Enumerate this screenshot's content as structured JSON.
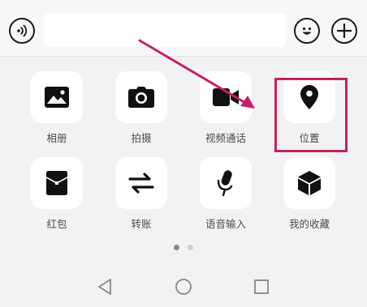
{
  "input_bar": {
    "message_value": "",
    "voice_icon": "voice-icon",
    "emoji_icon": "emoji-icon",
    "plus_icon": "plus-icon"
  },
  "panel": {
    "items": [
      {
        "label": "相册",
        "icon": "photo-album-icon"
      },
      {
        "label": "拍摄",
        "icon": "camera-icon"
      },
      {
        "label": "视频通话",
        "icon": "video-call-icon"
      },
      {
        "label": "位置",
        "icon": "location-pin-icon"
      },
      {
        "label": "红包",
        "icon": "red-packet-icon"
      },
      {
        "label": "转账",
        "icon": "transfer-icon"
      },
      {
        "label": "语音输入",
        "icon": "microphone-icon"
      },
      {
        "label": "我的收藏",
        "icon": "favorites-cube-icon"
      }
    ]
  },
  "pager": {
    "current_page": 1,
    "total_pages": 2
  },
  "navbar": {
    "back_icon": "back-triangle-icon",
    "home_icon": "home-circle-icon",
    "recent_icon": "recent-apps-square-icon"
  },
  "annotation": {
    "highlight_color": "#c81e6a",
    "highlighted_item": "位置"
  }
}
